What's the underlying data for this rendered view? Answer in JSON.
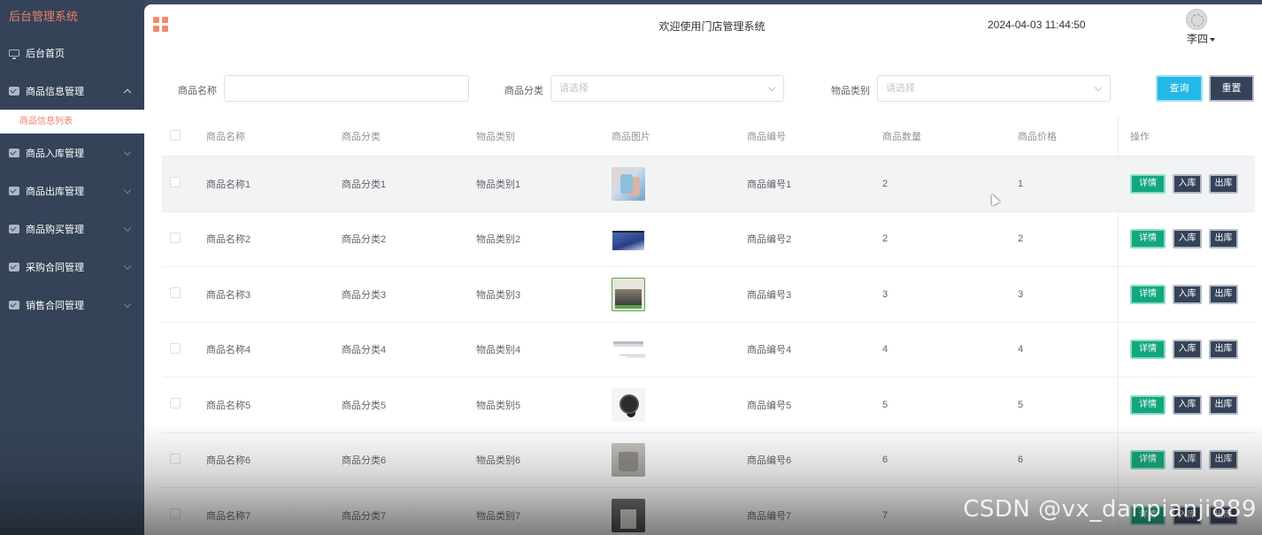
{
  "sidebar": {
    "brand": "后台管理系统",
    "items": [
      {
        "label": "后台首页"
      },
      {
        "label": "商品信息管理"
      },
      {
        "label": "商品入库管理"
      },
      {
        "label": "商品出库管理"
      },
      {
        "label": "商品购买管理"
      },
      {
        "label": "采购合同管理"
      },
      {
        "label": "销售合同管理"
      }
    ],
    "active_submenu": "商品信息列表"
  },
  "header": {
    "welcome": "欢迎使用门店管理系统",
    "datetime": "2024-04-03 11:44:50",
    "username": "李四"
  },
  "search": {
    "name_label": "商品名称",
    "name_value": "",
    "category_label": "商品分类",
    "category_placeholder": "请选择",
    "type_label": "物品类别",
    "type_placeholder": "请选择",
    "query_button": "查询",
    "reset_button": "重置"
  },
  "table": {
    "columns": [
      "商品名称",
      "商品分类",
      "物品类别",
      "商品图片",
      "商品编号",
      "商品数量",
      "商品价格",
      "操作"
    ],
    "ops": {
      "detail": "详情",
      "in": "入库",
      "out": "出库"
    },
    "rows": [
      {
        "name": "商品名称1",
        "category": "商品分类1",
        "type": "物品类别1",
        "code": "商品编号1",
        "qty": "2",
        "price": "1"
      },
      {
        "name": "商品名称2",
        "category": "商品分类2",
        "type": "物品类别2",
        "code": "商品编号2",
        "qty": "2",
        "price": "2"
      },
      {
        "name": "商品名称3",
        "category": "商品分类3",
        "type": "物品类别3",
        "code": "商品编号3",
        "qty": "3",
        "price": "3"
      },
      {
        "name": "商品名称4",
        "category": "商品分类4",
        "type": "物品类别4",
        "code": "商品编号4",
        "qty": "4",
        "price": "4"
      },
      {
        "name": "商品名称5",
        "category": "商品分类5",
        "type": "物品类别5",
        "code": "商品编号5",
        "qty": "5",
        "price": "5"
      },
      {
        "name": "商品名称6",
        "category": "商品分类6",
        "type": "物品类别6",
        "code": "商品编号6",
        "qty": "6",
        "price": "6"
      },
      {
        "name": "商品名称7",
        "category": "商品分类7",
        "type": "物品类别7",
        "code": "商品编号7",
        "qty": "7",
        "price": ""
      }
    ]
  },
  "watermark": "CSDN @vx_danpianji889",
  "colors": {
    "sidebar_bg": "#344358",
    "accent": "#f07f6b",
    "query_button": "#24b8e6",
    "detail_button": "#13a77f"
  }
}
